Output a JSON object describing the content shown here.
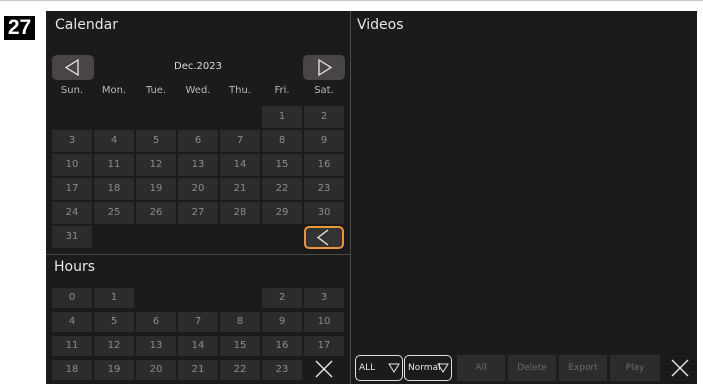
{
  "page_number": "27",
  "calendar": {
    "title": "Calendar",
    "month_label": "Dec.2023",
    "weekdays": [
      "Sun.",
      "Mon.",
      "Tue.",
      "Wed.",
      "Thu.",
      "Fri.",
      "Sat."
    ],
    "weeks": [
      [
        "",
        "",
        "",
        "",
        "",
        "1",
        "2"
      ],
      [
        "3",
        "4",
        "5",
        "6",
        "7",
        "8",
        "9"
      ],
      [
        "10",
        "11",
        "12",
        "13",
        "14",
        "15",
        "16"
      ],
      [
        "17",
        "18",
        "19",
        "20",
        "21",
        "22",
        "23"
      ],
      [
        "24",
        "25",
        "26",
        "27",
        "28",
        "29",
        "30"
      ],
      [
        "31",
        "",
        "",
        "",
        "",
        "",
        ""
      ]
    ]
  },
  "hours": {
    "title": "Hours",
    "rows": [
      [
        "0",
        "1",
        "",
        "",
        "",
        "2",
        "3"
      ],
      [
        "4",
        "5",
        "6",
        "7",
        "8",
        "9",
        "10"
      ],
      [
        "11",
        "12",
        "13",
        "14",
        "15",
        "16",
        "17"
      ],
      [
        "18",
        "19",
        "20",
        "21",
        "22",
        "23",
        ""
      ]
    ]
  },
  "videos": {
    "title": "Videos"
  },
  "toolbar": {
    "filter_all": "ALL",
    "filter_type": "Normal",
    "all_label": "All",
    "delete_label": "Delete",
    "export_label": "Export",
    "play_label": "Play"
  },
  "icons": {
    "prev_month": "triangle-left-icon",
    "next_month": "triangle-right-icon",
    "back": "chevron-left-icon",
    "close": "close-icon",
    "dropdown": "triangle-down-icon"
  },
  "colors": {
    "background": "#1b1b1b",
    "cell": "#2c2c2c",
    "highlight": "#e9963b"
  }
}
